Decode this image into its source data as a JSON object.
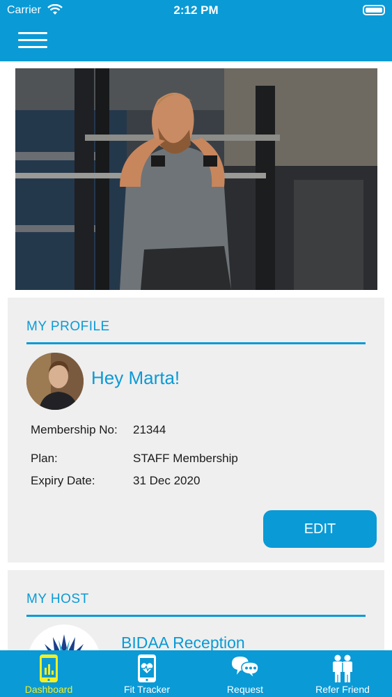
{
  "status_bar": {
    "carrier": "Carrier",
    "time": "2:12 PM"
  },
  "header": {
    "menu_icon": "hamburger-menu-icon"
  },
  "profile": {
    "title": "MY PROFILE",
    "greeting": "Hey Marta!",
    "rows": [
      {
        "label": "Membership No:",
        "value": "21344"
      },
      {
        "label": "Plan:",
        "value": "STAFF Membership"
      },
      {
        "label": "Expiry Date:",
        "value": "31 Dec 2020"
      }
    ],
    "edit_label": "EDIT"
  },
  "host": {
    "title": "MY HOST",
    "name": "BIDAA Reception"
  },
  "tabs": [
    {
      "label": "Dashboard",
      "icon": "phone-chart-icon",
      "active": true
    },
    {
      "label": "Fit Tracker",
      "icon": "phone-heart-icon",
      "active": false
    },
    {
      "label": "Request",
      "icon": "chat-bubbles-icon",
      "active": false
    },
    {
      "label": "Refer Friend",
      "icon": "people-icon",
      "active": false
    }
  ],
  "colors": {
    "brand": "#0a9ad6",
    "active_tab": "#f3ef24",
    "card_bg": "#efefef"
  }
}
